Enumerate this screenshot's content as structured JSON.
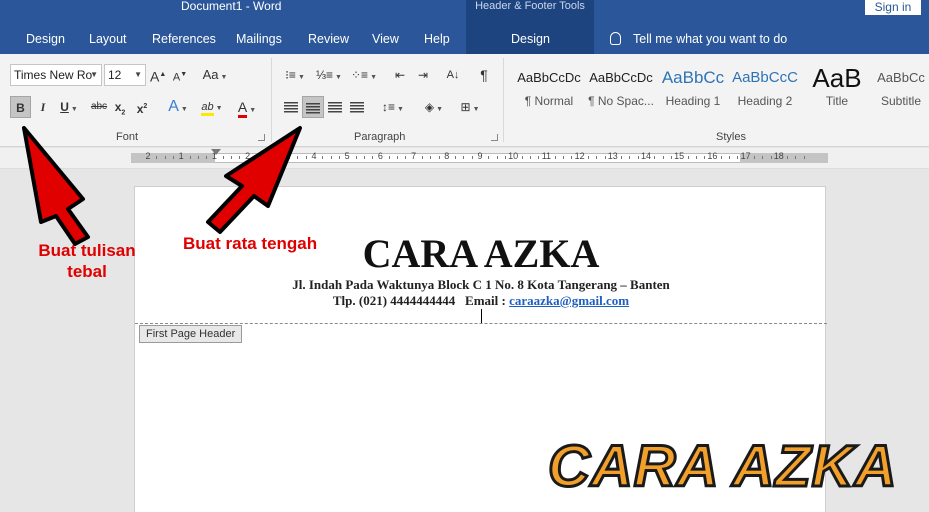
{
  "window": {
    "title": "Document1  -  Word",
    "context_group": "Header & Footer Tools",
    "sign_in": "Sign in"
  },
  "tabs": [
    "Design",
    "Layout",
    "References",
    "Mailings",
    "Review",
    "View",
    "Help",
    "Design"
  ],
  "active_tab_index": 7,
  "tell_me": "Tell me what you want to do",
  "font_group": {
    "label": "Font",
    "font_name": "Times New Ro",
    "font_size": "12",
    "grow_label": "A",
    "shrink_label": "A",
    "case_label": "Aa",
    "bold": "B",
    "italic": "I",
    "underline": "U",
    "strike": "abc",
    "subscript": "x",
    "subscript_mark": "2",
    "superscript": "x",
    "superscript_mark": "2",
    "effects": "A",
    "highlight": "ab",
    "color": "A",
    "bold_active": true
  },
  "paragraph_group": {
    "label": "Paragraph",
    "sort": "A↓",
    "pilcrow": "¶",
    "center_active": true
  },
  "styles_group": {
    "label": "Styles",
    "items": [
      {
        "preview": "AaBbCcDc",
        "name": "¶ Normal"
      },
      {
        "preview": "AaBbCcDc",
        "name": "¶ No Spac..."
      },
      {
        "preview": "AaBbCc",
        "name": "Heading 1"
      },
      {
        "preview": "AaBbCcC",
        "name": "Heading 2"
      },
      {
        "preview": "AaB",
        "name": "Title"
      },
      {
        "preview": "AaBbCc",
        "name": "Subtitle"
      }
    ]
  },
  "ruler": {
    "numbers": [
      "2",
      "1",
      "1",
      "2",
      "3",
      "4",
      "5",
      "6",
      "7",
      "8",
      "9",
      "10",
      "11",
      "12",
      "13",
      "14",
      "15",
      "16",
      "17",
      "18"
    ]
  },
  "document": {
    "title": "CARA AZKA",
    "address": "Jl. Indah Pada Waktunya Block C 1 No. 8 Kota Tangerang – Banten",
    "contact_prefix": "Tlp. (021) 4444444444   Email : ",
    "email": "caraazka@gmail.com",
    "header_tag": "First Page Header"
  },
  "annotations": {
    "bold_note_line1": "Buat tulisan",
    "bold_note_line2": "tebal",
    "center_note": "Buat rata tengah",
    "watermark": "CARA AZKA",
    "arrow_color": "#e00000"
  },
  "colors": {
    "titlebar": "#2b579a",
    "context_tab": "#1e4480",
    "ribbon": "#f3f3f3",
    "link": "#1f5fbf",
    "highlight_yellow": "#ffe800",
    "font_color_red": "#e00000"
  }
}
